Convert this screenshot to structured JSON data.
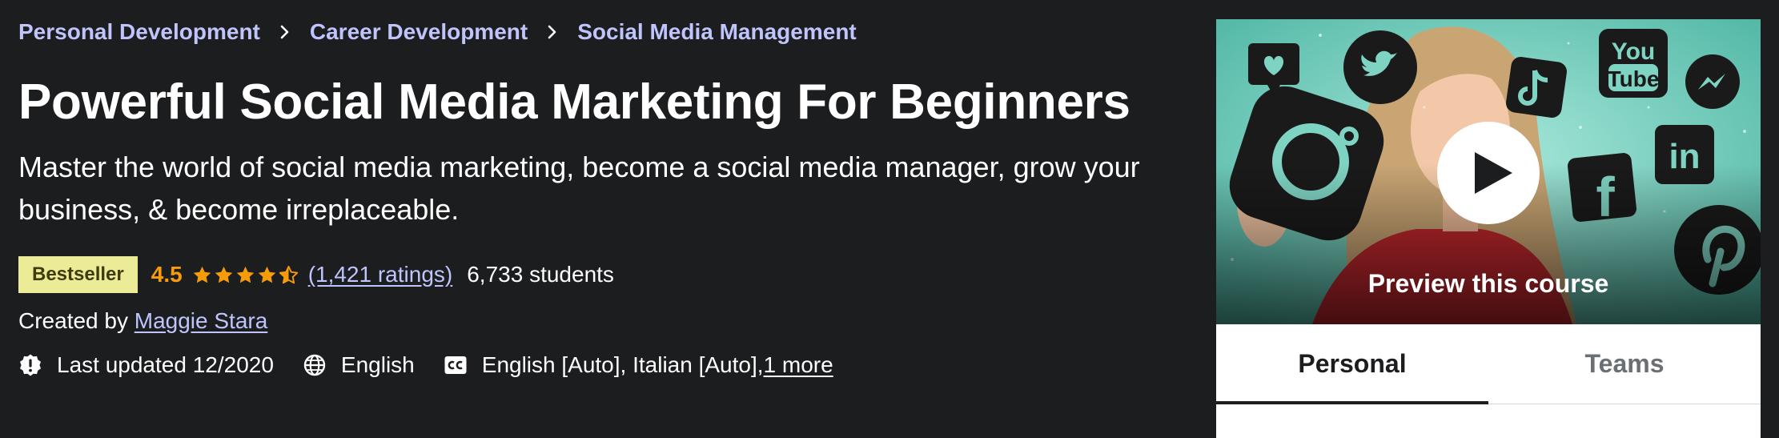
{
  "breadcrumb": {
    "items": [
      {
        "label": "Personal Development"
      },
      {
        "label": "Career Development"
      },
      {
        "label": "Social Media Management"
      }
    ]
  },
  "course": {
    "title": "Powerful Social Media Marketing For Beginners",
    "subtitle": "Master the world of social media marketing, become a social media manager, grow your business, & become irreplaceable.",
    "badge": "Bestseller",
    "rating": "4.5",
    "rating_value": 4.5,
    "rating_max": 5,
    "ratings_count": "(1,421 ratings)",
    "students": "6,733 students",
    "created_by_label": "Created by",
    "author": "Maggie Stara",
    "last_updated": "Last updated 12/2020",
    "language": "English",
    "captions": "English [Auto], Italian [Auto],",
    "captions_more": "1 more"
  },
  "preview": {
    "label": "Preview this course",
    "icons": [
      "heart-speech-icon",
      "twitter-icon",
      "tiktok-icon",
      "youtube-icon",
      "messenger-icon",
      "instagram-icon",
      "linkedin-icon",
      "facebook-icon",
      "pinterest-icon"
    ]
  },
  "tabs": [
    {
      "label": "Personal",
      "active": true
    },
    {
      "label": "Teams",
      "active": false
    }
  ],
  "colors": {
    "background": "#1c1d1f",
    "link": "#c0c4fc",
    "badge_bg": "#eceb98",
    "badge_text": "#3d3c0a",
    "star": "#f69c08",
    "preview_bg": "#6fcab9"
  }
}
